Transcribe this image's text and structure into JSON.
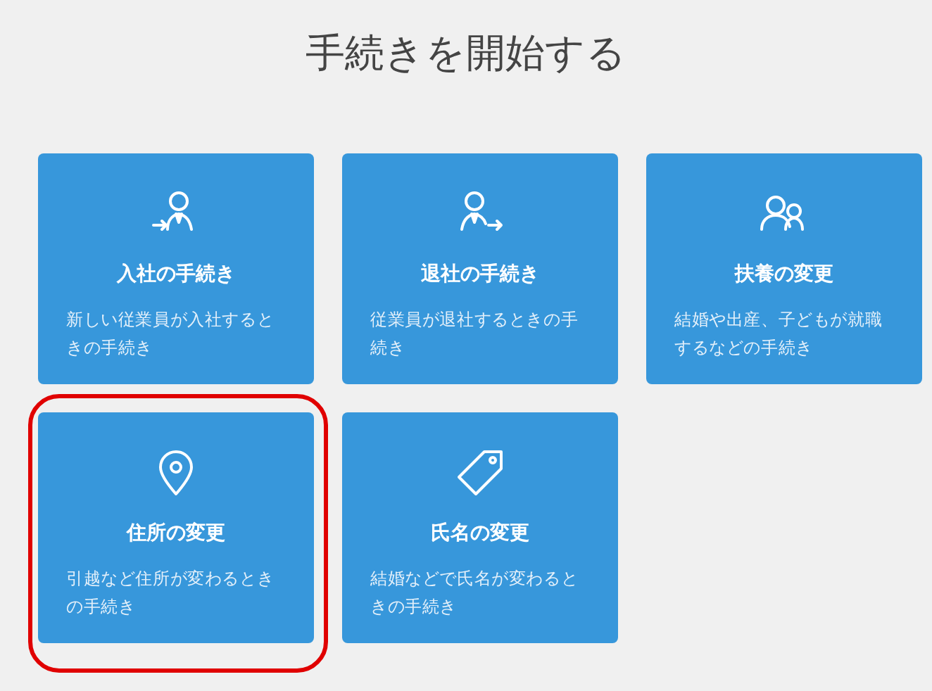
{
  "title": "手続きを開始する",
  "cards": [
    {
      "kind": "person-in",
      "title": "入社の手続き",
      "description": "新しい従業員が入社するときの手続き",
      "highlighted": false
    },
    {
      "kind": "person-out",
      "title": "退社の手続き",
      "description": "従業員が退社するときの手続き",
      "highlighted": false
    },
    {
      "kind": "people",
      "title": "扶養の変更",
      "description": "結婚や出産、子どもが就職するなどの手続き",
      "highlighted": false
    },
    {
      "kind": "pin",
      "title": "住所の変更",
      "description": "引越など住所が変わるときの手続き",
      "highlighted": true
    },
    {
      "kind": "tag",
      "title": "氏名の変更",
      "description": "結婚などで氏名が変わるときの手続き",
      "highlighted": false
    }
  ]
}
